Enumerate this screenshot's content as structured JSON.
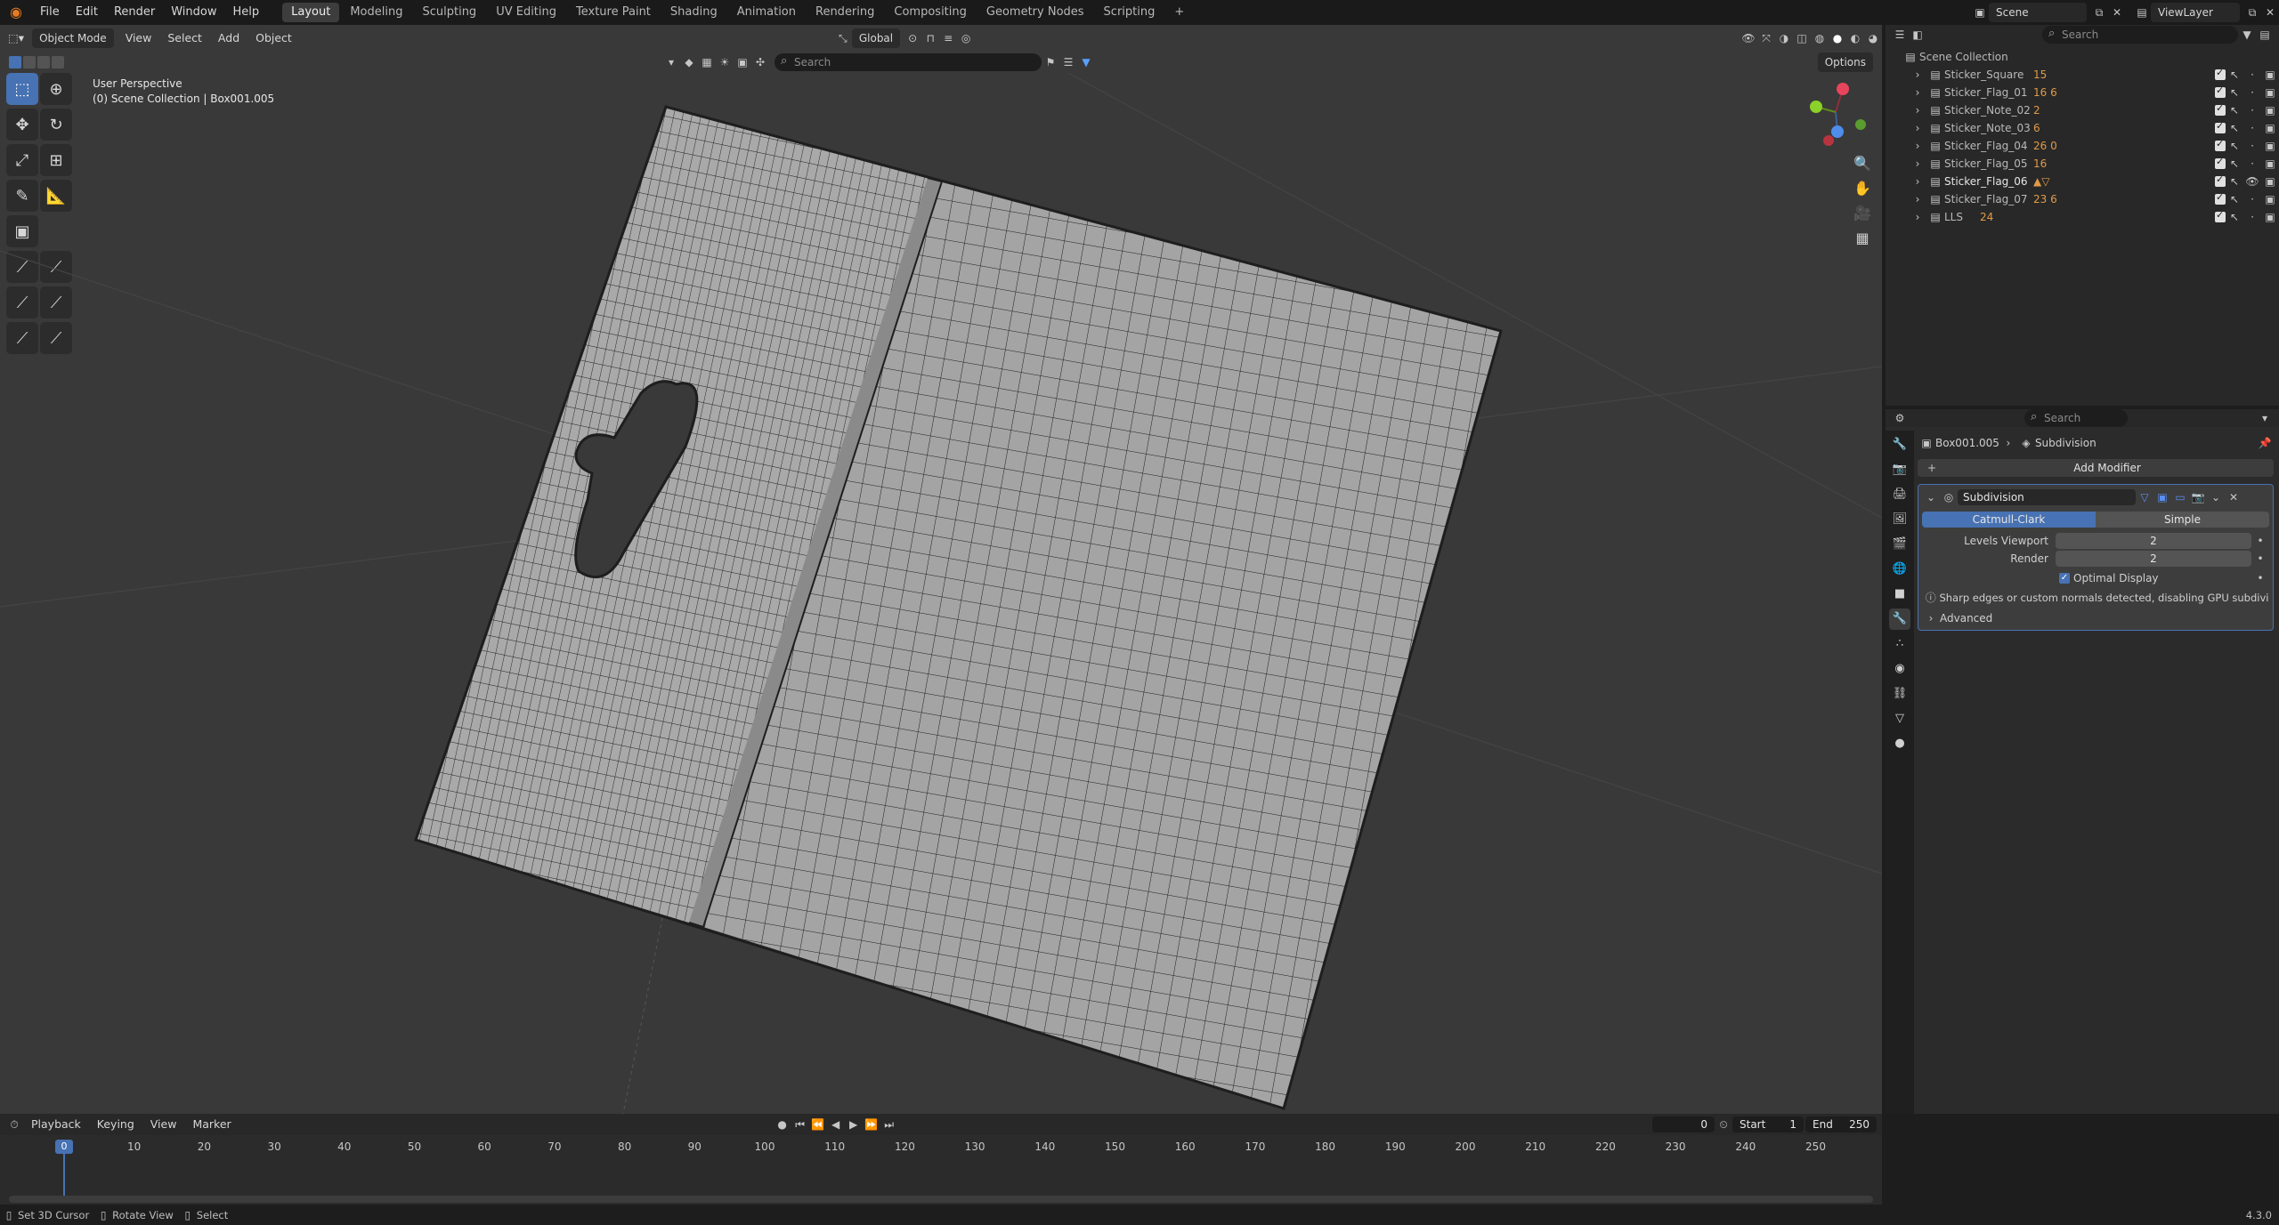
{
  "menus": [
    "File",
    "Edit",
    "Render",
    "Window",
    "Help"
  ],
  "workspaces": [
    "Layout",
    "Modeling",
    "Sculpting",
    "UV Editing",
    "Texture Paint",
    "Shading",
    "Animation",
    "Rendering",
    "Compositing",
    "Geometry Nodes",
    "Scripting"
  ],
  "active_workspace": "Layout",
  "scene": "Scene",
  "view_layer": "ViewLayer",
  "viewport": {
    "mode": "Object Mode",
    "menus": [
      "View",
      "Select",
      "Add",
      "Object"
    ],
    "orientation": "Global",
    "options": "Options",
    "search_placeholder": "Search",
    "info_line1": "User Perspective",
    "info_line2": "(0) Scene Collection | Box001.005"
  },
  "outliner": {
    "search_placeholder": "Search",
    "root": "Scene Collection",
    "items": [
      {
        "name": "Sticker_Square",
        "badge": "15"
      },
      {
        "name": "Sticker_Flag_01",
        "badge": "16 6"
      },
      {
        "name": "Sticker_Note_02",
        "badge": "2"
      },
      {
        "name": "Sticker_Note_03",
        "badge": "6"
      },
      {
        "name": "Sticker_Flag_04",
        "badge": "26 0"
      },
      {
        "name": "Sticker_Flag_05",
        "badge": "16"
      },
      {
        "name": "Sticker_Flag_06",
        "badge": ""
      },
      {
        "name": "Sticker_Flag_07",
        "badge": "23 6"
      },
      {
        "name": "LLS",
        "badge": "24"
      }
    ]
  },
  "properties": {
    "search_placeholder": "Search",
    "object": "Box001.005",
    "modifier_context": "Subdivision",
    "add_modifier": "Add Modifier",
    "modifier_name": "Subdivision",
    "type_a": "Catmull-Clark",
    "type_b": "Simple",
    "levels_viewport_label": "Levels Viewport",
    "levels_viewport": "2",
    "render_label": "Render",
    "render": "2",
    "optimal_display": "Optimal Display",
    "warning": "Sharp edges or custom normals detected, disabling GPU subdivi...",
    "advanced": "Advanced"
  },
  "timeline": {
    "menus": [
      "Playback",
      "Keying",
      "View",
      "Marker"
    ],
    "current_frame": "0",
    "start_label": "Start",
    "start": "1",
    "end_label": "End",
    "end": "250",
    "ticks": [
      "0",
      "10",
      "20",
      "30",
      "40",
      "50",
      "60",
      "70",
      "80",
      "90",
      "100",
      "110",
      "120",
      "130",
      "140",
      "150",
      "160",
      "170",
      "180",
      "190",
      "200",
      "210",
      "220",
      "230",
      "240",
      "250"
    ]
  },
  "status": {
    "hint1": "Set 3D Cursor",
    "hint2": "Rotate View",
    "hint3": "Select",
    "version": "4.3.0"
  },
  "colors": {
    "accent": "#4772b3",
    "viewport_bg": "#393939",
    "mesh": "#a9a9a9",
    "wire": "#1e1e1e"
  }
}
